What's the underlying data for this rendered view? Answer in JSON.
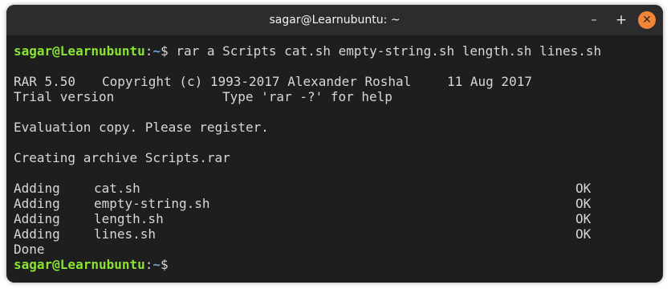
{
  "window": {
    "title": "sagar@Learnubuntu: ~",
    "min_glyph": "–",
    "max_glyph": "+",
    "close_glyph": "✕"
  },
  "prompt": {
    "user_host": "sagar@Learnubuntu",
    "colon": ":",
    "path": "~",
    "symbol": "$"
  },
  "command": " rar a Scripts cat.sh empty-string.sh length.sh lines.sh",
  "header": {
    "version": "RAR 5.50",
    "copyright": "Copyright (c) 1993-2017 Alexander Roshal",
    "date": "11 Aug 2017",
    "trial": "Trial version",
    "help": "Type 'rar -?' for help"
  },
  "evaluation": "Evaluation copy. Please register.",
  "creating": "Creating archive Scripts.rar",
  "adding": [
    {
      "action": "Adding",
      "file": "cat.sh",
      "status": "OK"
    },
    {
      "action": "Adding",
      "file": "empty-string.sh",
      "status": "OK"
    },
    {
      "action": "Adding",
      "file": "length.sh",
      "status": "OK"
    },
    {
      "action": "Adding",
      "file": "lines.sh",
      "status": "OK"
    }
  ],
  "done": "Done",
  "colors": {
    "prompt_user": "#8ae234",
    "prompt_path": "#729fcf",
    "close_button": "#f08437",
    "terminal_bg": "#1e1e1e",
    "text": "#d7d7d7"
  }
}
